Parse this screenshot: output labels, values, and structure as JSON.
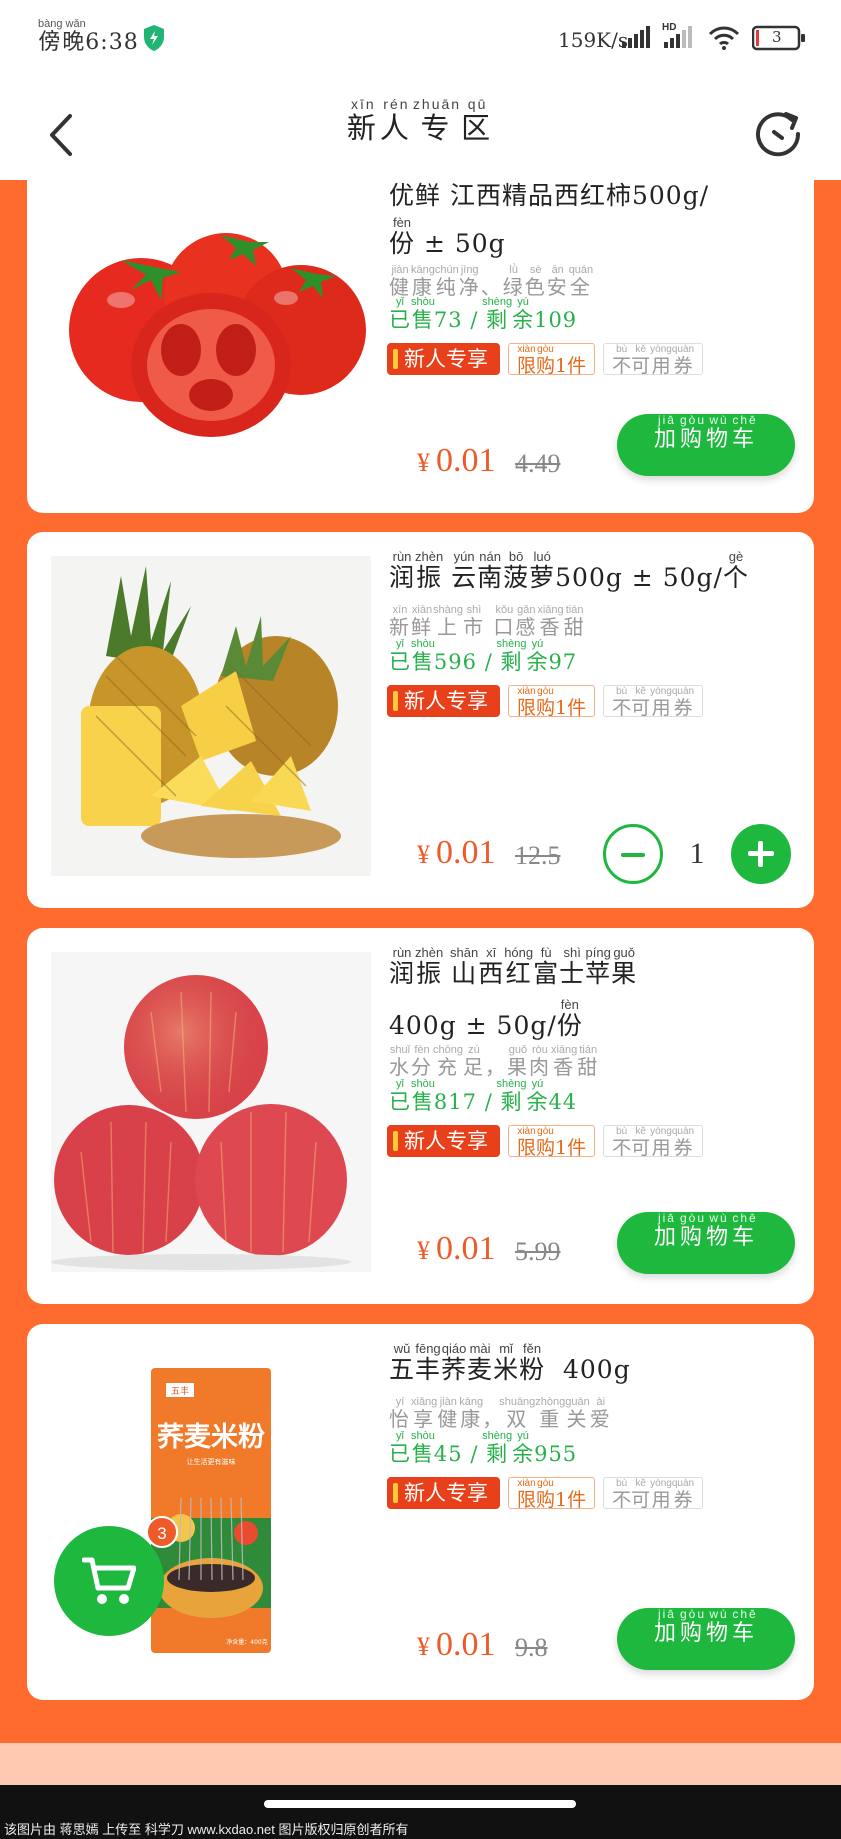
{
  "status_bar": {
    "time_pinyin": "bàng wǎn",
    "time_chars": "傍晚",
    "time": "6:38",
    "net_speed": "159K/s",
    "hd_label": "HD",
    "battery": "3"
  },
  "header": {
    "title_ruby": [
      {
        "char": "新",
        "pinyin": "xīn"
      },
      {
        "char": "人",
        "pinyin": "rén"
      },
      {
        "char": "专",
        "pinyin": "zhuān"
      },
      {
        "char": "区",
        "pinyin": "qū"
      }
    ]
  },
  "common": {
    "tag_new": "新人专享",
    "tag_limit": [
      {
        "char": "限",
        "pinyin": "xiàn"
      },
      {
        "char": "购",
        "pinyin": "gòu"
      }
    ],
    "tag_limit_suffix": "1件",
    "tag_coupon": [
      {
        "char": "不",
        "pinyin": "bù"
      },
      {
        "char": "可",
        "pinyin": "kě"
      },
      {
        "char": "用券",
        "pinyin": "yòngquàn"
      }
    ],
    "sold": [
      {
        "char": "已",
        "pinyin": "yǐ"
      },
      {
        "char": "售",
        "pinyin": "shòu"
      }
    ],
    "remain": [
      {
        "char": "剩",
        "pinyin": "shèng"
      },
      {
        "char": "余",
        "pinyin": "yú"
      }
    ],
    "currency": "¥",
    "cart_button": [
      {
        "char": "加",
        "pinyin": "jiā"
      },
      {
        "char": "购",
        "pinyin": "gòu"
      },
      {
        "char": "物",
        "pinyin": "wù"
      },
      {
        "char": "车",
        "pinyin": "chē"
      }
    ]
  },
  "products": [
    {
      "title_line1": "优鲜 江西精品西红柿500g/",
      "title_line2_ruby": {
        "char": "份",
        "pinyin": "fèn"
      },
      "title_line2_suffix": " ± 50g",
      "subtitle": [
        {
          "char": "健",
          "pinyin": "jiàn"
        },
        {
          "char": "康",
          "pinyin": "kāng"
        },
        {
          "char": "纯",
          "pinyin": "chún"
        },
        {
          "char": "净",
          "pinyin": "jìng"
        },
        {
          "char": "、",
          "pinyin": ""
        },
        {
          "char": "绿",
          "pinyin": "lǜ"
        },
        {
          "char": "色",
          "pinyin": "sè"
        },
        {
          "char": "安",
          "pinyin": "ān"
        },
        {
          "char": "全",
          "pinyin": "quán"
        }
      ],
      "sold": "73",
      "remain": "109",
      "price": "0.01",
      "orig_price": "4.49",
      "control": "cart"
    },
    {
      "title": [
        {
          "char": "润",
          "pinyin": "rùn"
        },
        {
          "char": "振",
          "pinyin": "zhèn"
        },
        {
          "char": " ",
          "pinyin": ""
        },
        {
          "char": "云",
          "pinyin": "yún"
        },
        {
          "char": "南",
          "pinyin": "nán"
        },
        {
          "char": "菠",
          "pinyin": "bō"
        },
        {
          "char": "萝",
          "pinyin": "luó"
        },
        {
          "char": "500g ± 50g/",
          "pinyin": ""
        },
        {
          "char": "个",
          "pinyin": "gè"
        }
      ],
      "subtitle": [
        {
          "char": "新",
          "pinyin": "xīn"
        },
        {
          "char": "鲜",
          "pinyin": "xiān"
        },
        {
          "char": "上",
          "pinyin": "shàng"
        },
        {
          "char": "市",
          "pinyin": "shì"
        },
        {
          "char": " ",
          "pinyin": ""
        },
        {
          "char": "口",
          "pinyin": "kǒu"
        },
        {
          "char": "感",
          "pinyin": "gǎn"
        },
        {
          "char": "香",
          "pinyin": "xiāng"
        },
        {
          "char": "甜",
          "pinyin": "tián"
        }
      ],
      "sold": "596",
      "remain": "97",
      "price": "0.01",
      "orig_price": "12.5",
      "control": "stepper",
      "qty": "1"
    },
    {
      "title": [
        {
          "char": "润",
          "pinyin": "rùn"
        },
        {
          "char": "振",
          "pinyin": "zhèn"
        },
        {
          "char": " ",
          "pinyin": ""
        },
        {
          "char": "山",
          "pinyin": "shān"
        },
        {
          "char": "西",
          "pinyin": "xī"
        },
        {
          "char": "红",
          "pinyin": "hóng"
        },
        {
          "char": "富",
          "pinyin": "fù"
        },
        {
          "char": "士",
          "pinyin": "shì"
        },
        {
          "char": "苹",
          "pinyin": "píng"
        },
        {
          "char": "果",
          "pinyin": "guǒ"
        }
      ],
      "title_line2_prefix": "400g ± 50g/",
      "title_line2_ruby": {
        "char": "份",
        "pinyin": "fèn"
      },
      "subtitle": [
        {
          "char": "水",
          "pinyin": "shuǐ"
        },
        {
          "char": "分",
          "pinyin": "fèn"
        },
        {
          "char": "充",
          "pinyin": "chōng"
        },
        {
          "char": "足",
          "pinyin": "zú"
        },
        {
          "char": "，",
          "pinyin": ""
        },
        {
          "char": "果",
          "pinyin": "guǒ"
        },
        {
          "char": "肉",
          "pinyin": "ròu"
        },
        {
          "char": "香",
          "pinyin": "xiāng"
        },
        {
          "char": "甜",
          "pinyin": "tián"
        }
      ],
      "sold": "817",
      "remain": "44",
      "price": "0.01",
      "orig_price": "5.99",
      "control": "cart"
    },
    {
      "title": [
        {
          "char": "五",
          "pinyin": "wǔ"
        },
        {
          "char": "丰",
          "pinyin": "fēng"
        },
        {
          "char": "荞",
          "pinyin": "qiáo"
        },
        {
          "char": "麦",
          "pinyin": "mài"
        },
        {
          "char": "米",
          "pinyin": "mǐ"
        },
        {
          "char": "粉",
          "pinyin": "fěn"
        },
        {
          "char": "  400g",
          "pinyin": ""
        }
      ],
      "subtitle": [
        {
          "char": "怡",
          "pinyin": "yí"
        },
        {
          "char": "享",
          "pinyin": "xiǎng"
        },
        {
          "char": "健",
          "pinyin": "jiàn"
        },
        {
          "char": "康",
          "pinyin": "kāng"
        },
        {
          "char": "，",
          "pinyin": ""
        },
        {
          "char": "双",
          "pinyin": "shuāng"
        },
        {
          "char": "重",
          "pinyin": "zhòng"
        },
        {
          "char": "关",
          "pinyin": "guān"
        },
        {
          "char": "爱",
          "pinyin": "ài"
        }
      ],
      "sold": "45",
      "remain": "955",
      "price": "0.01",
      "orig_price": "9.8",
      "control": "cart",
      "package_brand": "五丰",
      "package_name": "荞麦米粉",
      "package_slogan": "让生活更有滋味",
      "package_weight": "净含量：400克"
    }
  ],
  "floating_cart": {
    "badge": "3"
  },
  "watermark": "该图片由 蒋思嫣 上传至 科学刀 www.kxdao.net 图片版权归原创者所有",
  "colors": {
    "accent": "#ff6a2e",
    "green": "#1fb83f",
    "price": "#ef5a2a",
    "tag_red": "#e8401a"
  }
}
